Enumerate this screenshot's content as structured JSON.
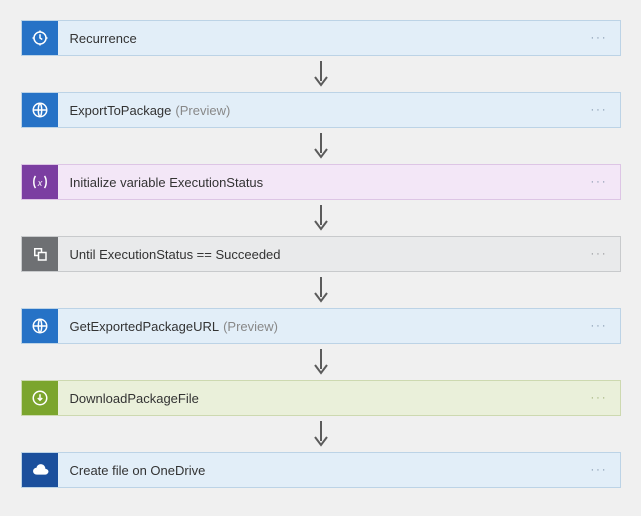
{
  "steps": [
    {
      "label": "Recurrence",
      "preview": "",
      "theme": "blue",
      "icon": "clock"
    },
    {
      "label": "ExportToPackage",
      "preview": "(Preview)",
      "theme": "blue",
      "icon": "globe"
    },
    {
      "label": "Initialize variable ExecutionStatus",
      "preview": "",
      "theme": "purple",
      "icon": "variable"
    },
    {
      "label": "Until ExecutionStatus == Succeeded",
      "preview": "",
      "theme": "gray",
      "icon": "loop"
    },
    {
      "label": "GetExportedPackageURL",
      "preview": "(Preview)",
      "theme": "blue",
      "icon": "globe"
    },
    {
      "label": "DownloadPackageFile",
      "preview": "",
      "theme": "green",
      "icon": "download"
    },
    {
      "label": "Create file on OneDrive",
      "preview": "",
      "theme": "od",
      "icon": "cloud"
    }
  ],
  "menu_glyph": "···"
}
